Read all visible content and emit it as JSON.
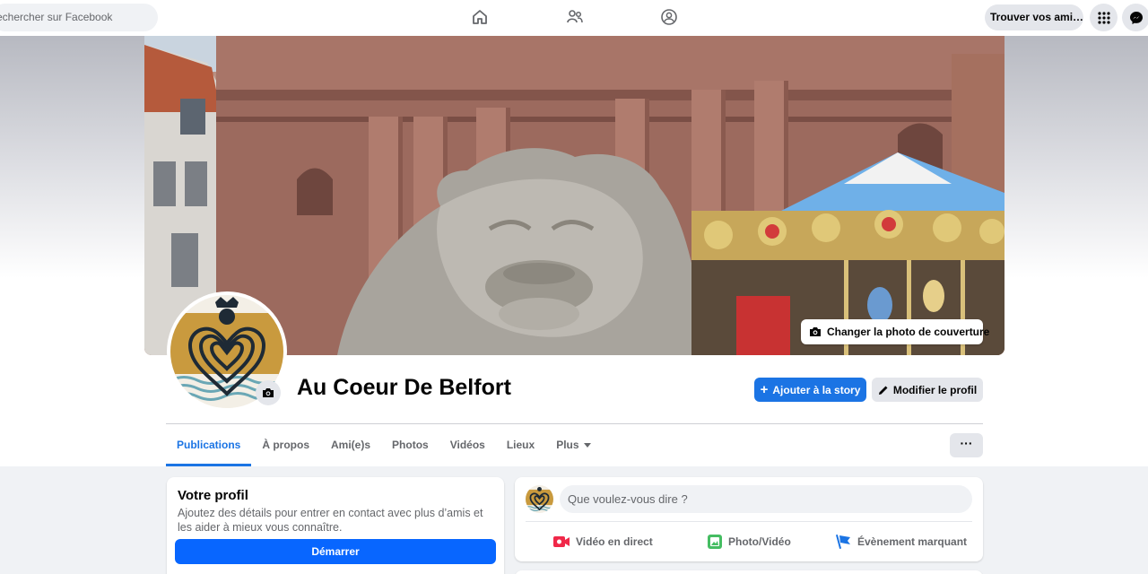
{
  "topbar": {
    "search_placeholder": "echercher sur Facebook",
    "find_friends_label": "Trouver vos ami…",
    "icons": [
      "home-icon",
      "friends-icon",
      "groups-icon",
      "apps-grid-icon",
      "messenger-icon"
    ]
  },
  "cover": {
    "change_cover_label": "Changer la photo de couverture"
  },
  "profile": {
    "name": "Au Coeur De Belfort",
    "add_story_label": "Ajouter à la story",
    "edit_profile_label": "Modifier le profil"
  },
  "tabs": [
    {
      "label": "Publications",
      "active": true
    },
    {
      "label": "À propos"
    },
    {
      "label": "Ami(e)s"
    },
    {
      "label": "Photos"
    },
    {
      "label": "Vidéos"
    },
    {
      "label": "Lieux"
    },
    {
      "label": "Plus"
    }
  ],
  "more_button_label": "···",
  "profile_card": {
    "title": "Votre profil",
    "description": "Ajoutez des détails pour entrer en contact avec plus d’amis et les aider à mieux vous connaître.",
    "start_label": "Démarrer"
  },
  "composer": {
    "placeholder": "Que voulez-vous dire ?",
    "actions": [
      {
        "label": "Vidéo en direct",
        "icon": "live-video-icon",
        "color": "#f02849"
      },
      {
        "label": "Photo/Vidéo",
        "icon": "photo-video-icon",
        "color": "#45bd62"
      },
      {
        "label": "Évènement marquant",
        "icon": "flag-icon",
        "color": "#1b74e4"
      }
    ]
  },
  "colors": {
    "accent": "#1b74e4",
    "background": "#f0f2f5"
  }
}
